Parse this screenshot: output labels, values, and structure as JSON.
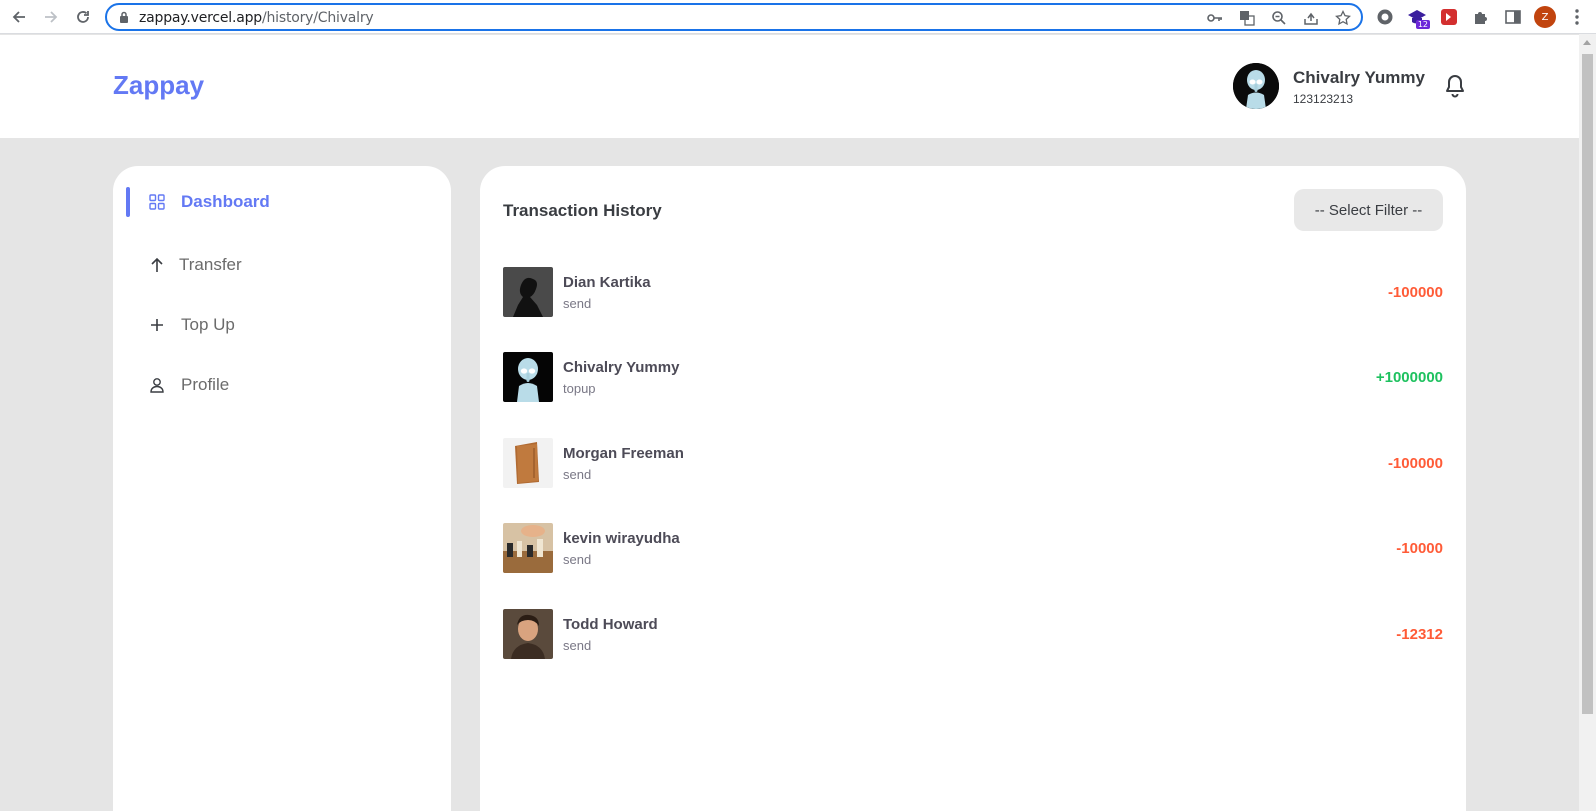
{
  "browser": {
    "url_host": "zappay.vercel.app",
    "url_path": "/history/Chivalry",
    "extension_badge": "12",
    "profile_initial": "Z"
  },
  "header": {
    "logo": "Zappay",
    "user_name": "Chivalry Yummy",
    "user_phone": "123123213"
  },
  "sidebar": {
    "items": [
      {
        "label": "Dashboard",
        "icon": "grid-icon",
        "active": true
      },
      {
        "label": "Transfer",
        "icon": "arrow-up-icon",
        "active": false
      },
      {
        "label": "Top Up",
        "icon": "plus-icon",
        "active": false
      },
      {
        "label": "Profile",
        "icon": "user-icon",
        "active": false
      }
    ]
  },
  "history": {
    "title": "Transaction History",
    "filter_label": "-- Select Filter --",
    "transactions": [
      {
        "name": "Dian Kartika",
        "type": "send",
        "amount": "-100000",
        "color": "#ff5b37"
      },
      {
        "name": "Chivalry Yummy",
        "type": "topup",
        "amount": "+1000000",
        "color": "#1ec15f"
      },
      {
        "name": "Morgan Freeman",
        "type": "send",
        "amount": "-100000",
        "color": "#ff5b37"
      },
      {
        "name": "kevin wirayudha",
        "type": "send",
        "amount": "-10000",
        "color": "#ff5b37"
      },
      {
        "name": "Todd Howard",
        "type": "send",
        "amount": "-12312",
        "color": "#ff5b37"
      }
    ]
  },
  "colors": {
    "accent": "#6379f4",
    "negative": "#ff5b37",
    "positive": "#1ec15f"
  }
}
